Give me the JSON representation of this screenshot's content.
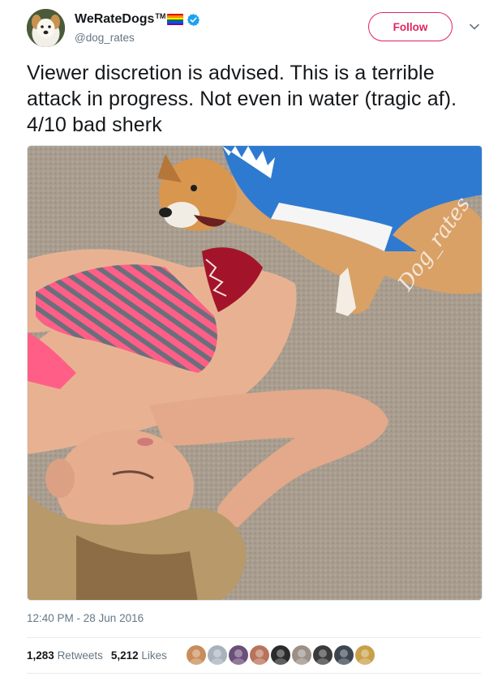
{
  "author": {
    "display_name": "WeRateDogs",
    "trademark": "TM",
    "handle": "@dog_rates",
    "avatar_icon": "dog-avatar-icon",
    "verified_icon": "verified-badge-icon",
    "pride_flag_colors": [
      "#e40303",
      "#ff8c00",
      "#ffed00",
      "#008026",
      "#004dff",
      "#750787"
    ]
  },
  "follow_label": "Follow",
  "menu_icon": "chevron-down-icon",
  "tweet_text": "Viewer discretion is advised. This is a terrible attack in progress. Not even in water (tragic af). 4/10 bad sherk",
  "media": {
    "watermark": "Dog_rates",
    "icon": "photo-icon"
  },
  "timestamp": "12:40 PM - 28 Jun 2016",
  "stats": {
    "retweets_count": "1,283",
    "retweets_label": "Retweets",
    "likes_count": "5,212",
    "likes_label": "Likes"
  },
  "liker_avatars": [
    {
      "icon": "liker-avatar-icon",
      "color": "#c98c5a"
    },
    {
      "icon": "liker-avatar-icon",
      "color": "#a8b2bd"
    },
    {
      "icon": "liker-avatar-icon",
      "color": "#6b4f7a"
    },
    {
      "icon": "liker-avatar-icon",
      "color": "#b8735a"
    },
    {
      "icon": "liker-avatar-icon",
      "color": "#2b2b2b"
    },
    {
      "icon": "liker-avatar-icon",
      "color": "#9c8f86"
    },
    {
      "icon": "liker-avatar-icon",
      "color": "#3a3a3a"
    },
    {
      "icon": "liker-avatar-icon",
      "color": "#3d4550"
    },
    {
      "icon": "liker-avatar-icon",
      "color": "#c9a04a"
    }
  ],
  "colors": {
    "follow_accent": "#e0245e",
    "verified_blue": "#1da1f2",
    "secondary_text": "#657786",
    "primary_text": "#14171a"
  }
}
